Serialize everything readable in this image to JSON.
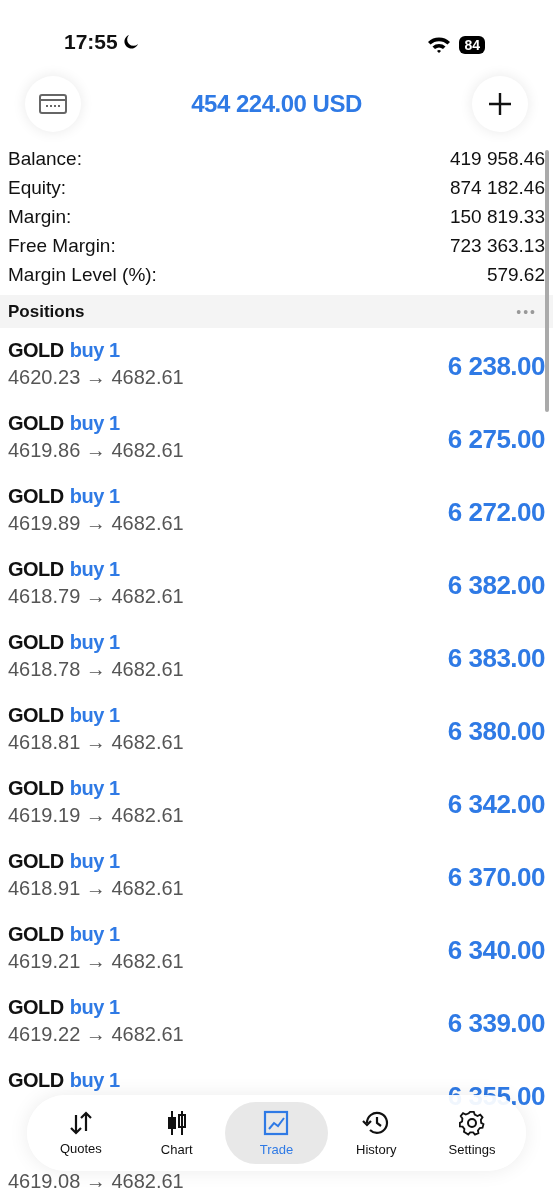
{
  "status_bar": {
    "time": "17:55",
    "battery": "84"
  },
  "header": {
    "title": "454 224.00 USD"
  },
  "account": [
    {
      "label": "Balance:",
      "value": "419 958.46"
    },
    {
      "label": "Equity:",
      "value": "874 182.46"
    },
    {
      "label": "Margin:",
      "value": "150 819.33"
    },
    {
      "label": "Free Margin:",
      "value": "723 363.13"
    },
    {
      "label": "Margin Level (%):",
      "value": "579.62"
    }
  ],
  "positions": {
    "title": "Positions",
    "more": "•••",
    "rows": [
      {
        "symbol": "GOLD",
        "side": "buy 1",
        "prices": "4620.23 → 4682.61",
        "profit": "6 238.00"
      },
      {
        "symbol": "GOLD",
        "side": "buy 1",
        "prices": "4619.86 → 4682.61",
        "profit": "6 275.00"
      },
      {
        "symbol": "GOLD",
        "side": "buy 1",
        "prices": "4619.89 → 4682.61",
        "profit": "6 272.00"
      },
      {
        "symbol": "GOLD",
        "side": "buy 1",
        "prices": "4618.79 → 4682.61",
        "profit": "6 382.00"
      },
      {
        "symbol": "GOLD",
        "side": "buy 1",
        "prices": "4618.78 → 4682.61",
        "profit": "6 383.00"
      },
      {
        "symbol": "GOLD",
        "side": "buy 1",
        "prices": "4618.81 → 4682.61",
        "profit": "6 380.00"
      },
      {
        "symbol": "GOLD",
        "side": "buy 1",
        "prices": "4619.19 → 4682.61",
        "profit": "6 342.00"
      },
      {
        "symbol": "GOLD",
        "side": "buy 1",
        "prices": "4618.91 → 4682.61",
        "profit": "6 370.00"
      },
      {
        "symbol": "GOLD",
        "side": "buy 1",
        "prices": "4619.21 → 4682.61",
        "profit": "6 340.00"
      },
      {
        "symbol": "GOLD",
        "side": "buy 1",
        "prices": "4619.22 → 4682.61",
        "profit": "6 339.00"
      },
      {
        "symbol": "GOLD",
        "side": "buy 1",
        "profit": "6 355.00"
      },
      {
        "prices": "4619.08 → 4682.61"
      }
    ]
  },
  "tabs": [
    {
      "label": "Quotes",
      "kind": "quotes",
      "selected": false
    },
    {
      "label": "Chart",
      "kind": "chart",
      "selected": false
    },
    {
      "label": "Trade",
      "kind": "trade",
      "selected": true
    },
    {
      "label": "History",
      "kind": "history",
      "selected": false
    },
    {
      "label": "Settings",
      "kind": "settings",
      "selected": false
    }
  ]
}
